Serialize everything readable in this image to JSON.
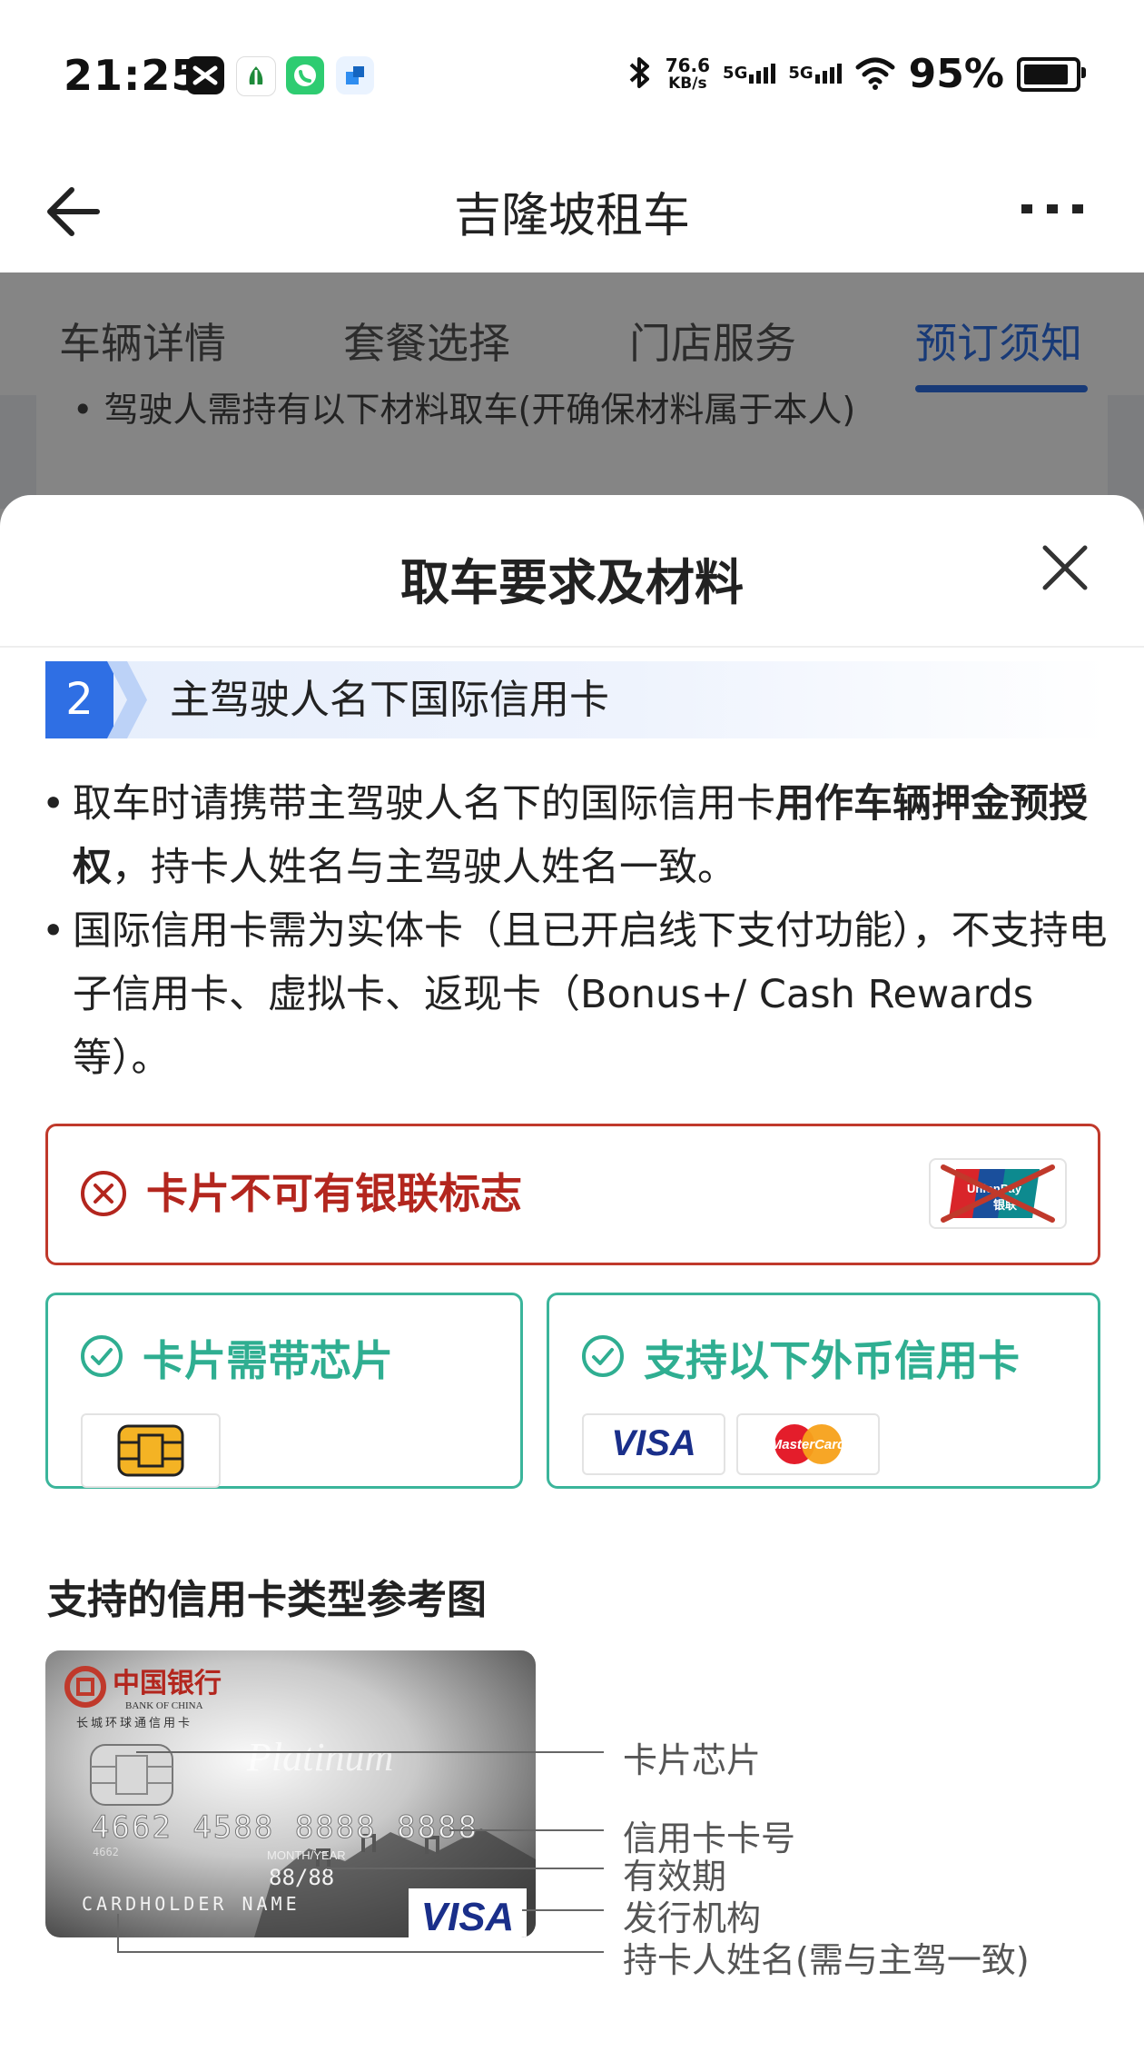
{
  "status_bar": {
    "time": "21:25",
    "network_speed_value": "76.6",
    "network_speed_unit": "KB/s",
    "sim1": "5G",
    "sim2": "5G",
    "battery_percent": "95%",
    "battery_level": 0.95
  },
  "header": {
    "title": "吉隆坡租车"
  },
  "tabs": [
    {
      "label": "车辆详情"
    },
    {
      "label": "套餐选择"
    },
    {
      "label": "门店服务"
    },
    {
      "label": "预订须知"
    }
  ],
  "underlay_text": "• 驾驶人需持有以下材料取车(开确保材料属于本人)",
  "sheet": {
    "title": "取车要求及材料",
    "step": {
      "number": "2",
      "title": "主驾驶人名下国际信用卡"
    },
    "bullet1": {
      "text_a": "取车时请携带主驾驶人名下的国际信用卡",
      "bold": "用作车辆押金预授权",
      "text_b": "，持卡人姓名与主驾驶人姓名一致。"
    },
    "bullet2": "国际信用卡需为实体卡（且已开启线下支付功能），不支持电子信用卡、虚拟卡、返现卡（Bonus+/ Cash Rewards等）。",
    "warning": {
      "text": "卡片不可有银联标志",
      "logo_text": "UnionPay 银联"
    },
    "requirement_chip": {
      "text": "卡片需带芯片"
    },
    "requirement_foreign": {
      "text": "支持以下外币信用卡",
      "brands": [
        "VISA",
        "MasterCard"
      ]
    },
    "reference": {
      "title": "支持的信用卡类型参考图",
      "card": {
        "bank_cn": "中国银行",
        "bank_en": "BANK OF CHINA",
        "card_line": "长城环球通信用卡",
        "tier": "Platinum",
        "number": "4662 4588 8888 8888",
        "small_number": "4662",
        "valid_label": "MONTH/YEAR",
        "expiry": "88/88",
        "holder": "CARDHOLDER NAME",
        "brand": "VISA"
      },
      "callouts": [
        "卡片芯片",
        "信用卡卡号",
        "有效期",
        "发行机构",
        "持卡人姓名(需与主驾一致)"
      ]
    }
  },
  "colors": {
    "accent_blue": "#2f6fe4",
    "warning_red": "#b3261e",
    "ok_green": "#2fae91"
  }
}
